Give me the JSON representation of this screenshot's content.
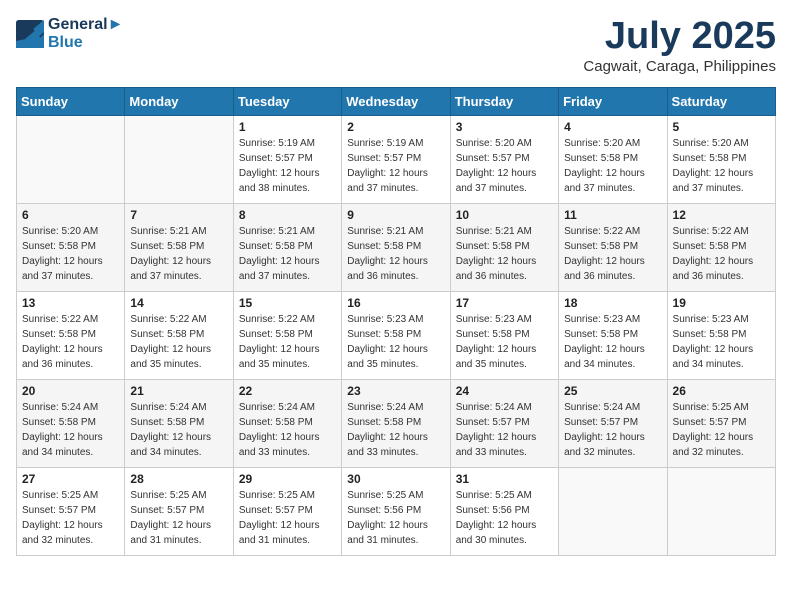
{
  "header": {
    "logo_line1": "General",
    "logo_line2": "Blue",
    "month": "July 2025",
    "location": "Cagwait, Caraga, Philippines"
  },
  "weekdays": [
    "Sunday",
    "Monday",
    "Tuesday",
    "Wednesday",
    "Thursday",
    "Friday",
    "Saturday"
  ],
  "weeks": [
    [
      {
        "day": "",
        "sunrise": "",
        "sunset": "",
        "daylight": ""
      },
      {
        "day": "",
        "sunrise": "",
        "sunset": "",
        "daylight": ""
      },
      {
        "day": "1",
        "sunrise": "Sunrise: 5:19 AM",
        "sunset": "Sunset: 5:57 PM",
        "daylight": "Daylight: 12 hours and 38 minutes."
      },
      {
        "day": "2",
        "sunrise": "Sunrise: 5:19 AM",
        "sunset": "Sunset: 5:57 PM",
        "daylight": "Daylight: 12 hours and 37 minutes."
      },
      {
        "day": "3",
        "sunrise": "Sunrise: 5:20 AM",
        "sunset": "Sunset: 5:57 PM",
        "daylight": "Daylight: 12 hours and 37 minutes."
      },
      {
        "day": "4",
        "sunrise": "Sunrise: 5:20 AM",
        "sunset": "Sunset: 5:58 PM",
        "daylight": "Daylight: 12 hours and 37 minutes."
      },
      {
        "day": "5",
        "sunrise": "Sunrise: 5:20 AM",
        "sunset": "Sunset: 5:58 PM",
        "daylight": "Daylight: 12 hours and 37 minutes."
      }
    ],
    [
      {
        "day": "6",
        "sunrise": "Sunrise: 5:20 AM",
        "sunset": "Sunset: 5:58 PM",
        "daylight": "Daylight: 12 hours and 37 minutes."
      },
      {
        "day": "7",
        "sunrise": "Sunrise: 5:21 AM",
        "sunset": "Sunset: 5:58 PM",
        "daylight": "Daylight: 12 hours and 37 minutes."
      },
      {
        "day": "8",
        "sunrise": "Sunrise: 5:21 AM",
        "sunset": "Sunset: 5:58 PM",
        "daylight": "Daylight: 12 hours and 37 minutes."
      },
      {
        "day": "9",
        "sunrise": "Sunrise: 5:21 AM",
        "sunset": "Sunset: 5:58 PM",
        "daylight": "Daylight: 12 hours and 36 minutes."
      },
      {
        "day": "10",
        "sunrise": "Sunrise: 5:21 AM",
        "sunset": "Sunset: 5:58 PM",
        "daylight": "Daylight: 12 hours and 36 minutes."
      },
      {
        "day": "11",
        "sunrise": "Sunrise: 5:22 AM",
        "sunset": "Sunset: 5:58 PM",
        "daylight": "Daylight: 12 hours and 36 minutes."
      },
      {
        "day": "12",
        "sunrise": "Sunrise: 5:22 AM",
        "sunset": "Sunset: 5:58 PM",
        "daylight": "Daylight: 12 hours and 36 minutes."
      }
    ],
    [
      {
        "day": "13",
        "sunrise": "Sunrise: 5:22 AM",
        "sunset": "Sunset: 5:58 PM",
        "daylight": "Daylight: 12 hours and 36 minutes."
      },
      {
        "day": "14",
        "sunrise": "Sunrise: 5:22 AM",
        "sunset": "Sunset: 5:58 PM",
        "daylight": "Daylight: 12 hours and 35 minutes."
      },
      {
        "day": "15",
        "sunrise": "Sunrise: 5:22 AM",
        "sunset": "Sunset: 5:58 PM",
        "daylight": "Daylight: 12 hours and 35 minutes."
      },
      {
        "day": "16",
        "sunrise": "Sunrise: 5:23 AM",
        "sunset": "Sunset: 5:58 PM",
        "daylight": "Daylight: 12 hours and 35 minutes."
      },
      {
        "day": "17",
        "sunrise": "Sunrise: 5:23 AM",
        "sunset": "Sunset: 5:58 PM",
        "daylight": "Daylight: 12 hours and 35 minutes."
      },
      {
        "day": "18",
        "sunrise": "Sunrise: 5:23 AM",
        "sunset": "Sunset: 5:58 PM",
        "daylight": "Daylight: 12 hours and 34 minutes."
      },
      {
        "day": "19",
        "sunrise": "Sunrise: 5:23 AM",
        "sunset": "Sunset: 5:58 PM",
        "daylight": "Daylight: 12 hours and 34 minutes."
      }
    ],
    [
      {
        "day": "20",
        "sunrise": "Sunrise: 5:24 AM",
        "sunset": "Sunset: 5:58 PM",
        "daylight": "Daylight: 12 hours and 34 minutes."
      },
      {
        "day": "21",
        "sunrise": "Sunrise: 5:24 AM",
        "sunset": "Sunset: 5:58 PM",
        "daylight": "Daylight: 12 hours and 34 minutes."
      },
      {
        "day": "22",
        "sunrise": "Sunrise: 5:24 AM",
        "sunset": "Sunset: 5:58 PM",
        "daylight": "Daylight: 12 hours and 33 minutes."
      },
      {
        "day": "23",
        "sunrise": "Sunrise: 5:24 AM",
        "sunset": "Sunset: 5:58 PM",
        "daylight": "Daylight: 12 hours and 33 minutes."
      },
      {
        "day": "24",
        "sunrise": "Sunrise: 5:24 AM",
        "sunset": "Sunset: 5:57 PM",
        "daylight": "Daylight: 12 hours and 33 minutes."
      },
      {
        "day": "25",
        "sunrise": "Sunrise: 5:24 AM",
        "sunset": "Sunset: 5:57 PM",
        "daylight": "Daylight: 12 hours and 32 minutes."
      },
      {
        "day": "26",
        "sunrise": "Sunrise: 5:25 AM",
        "sunset": "Sunset: 5:57 PM",
        "daylight": "Daylight: 12 hours and 32 minutes."
      }
    ],
    [
      {
        "day": "27",
        "sunrise": "Sunrise: 5:25 AM",
        "sunset": "Sunset: 5:57 PM",
        "daylight": "Daylight: 12 hours and 32 minutes."
      },
      {
        "day": "28",
        "sunrise": "Sunrise: 5:25 AM",
        "sunset": "Sunset: 5:57 PM",
        "daylight": "Daylight: 12 hours and 31 minutes."
      },
      {
        "day": "29",
        "sunrise": "Sunrise: 5:25 AM",
        "sunset": "Sunset: 5:57 PM",
        "daylight": "Daylight: 12 hours and 31 minutes."
      },
      {
        "day": "30",
        "sunrise": "Sunrise: 5:25 AM",
        "sunset": "Sunset: 5:56 PM",
        "daylight": "Daylight: 12 hours and 31 minutes."
      },
      {
        "day": "31",
        "sunrise": "Sunrise: 5:25 AM",
        "sunset": "Sunset: 5:56 PM",
        "daylight": "Daylight: 12 hours and 30 minutes."
      },
      {
        "day": "",
        "sunrise": "",
        "sunset": "",
        "daylight": ""
      },
      {
        "day": "",
        "sunrise": "",
        "sunset": "",
        "daylight": ""
      }
    ]
  ]
}
